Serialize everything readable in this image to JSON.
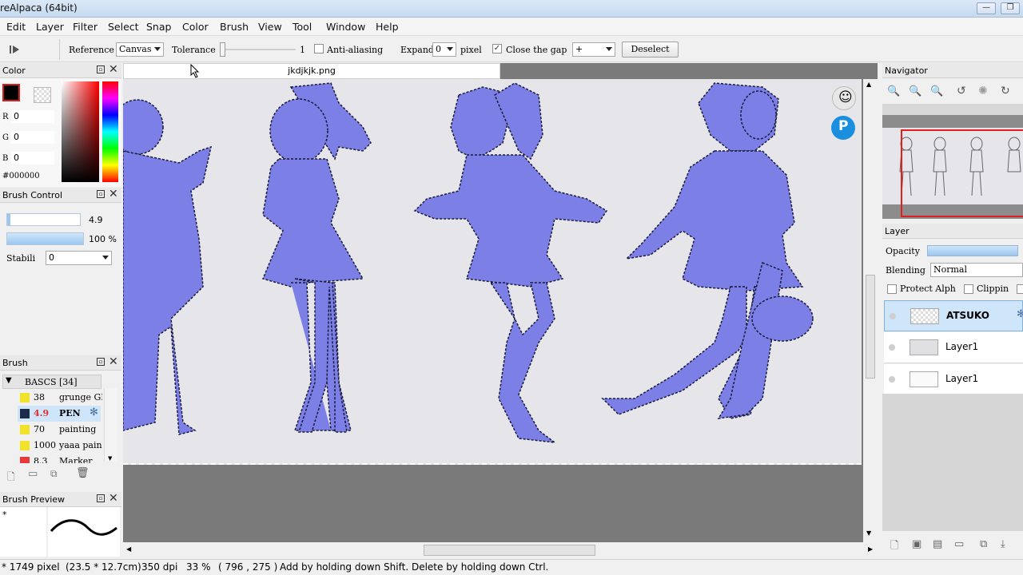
{
  "window": {
    "title": "reAlpaca (64bit)",
    "minimize": "—",
    "maximize": "❐"
  },
  "menu": [
    "Edit",
    "Layer",
    "Filter",
    "Select",
    "Snap",
    "Color",
    "Brush",
    "View",
    "Tool",
    "Window",
    "Help"
  ],
  "toolbar": {
    "reference_label": "Reference",
    "reference_value": "Canvas",
    "tolerance_label": "Tolerance",
    "tolerance_value": "1",
    "antialias_label": "Anti-aliasing",
    "expand_label": "Expand",
    "expand_value": "0",
    "pixel_label": "pixel",
    "close_gap_label": "Close the gap",
    "close_gap_value": "+",
    "deselect_label": "Deselect"
  },
  "color_panel": {
    "title": "Color",
    "r_label": "R",
    "r_value": "0",
    "g_label": "G",
    "g_value": "0",
    "b_label": "B",
    "b_value": "0",
    "hex": "#000000",
    "fg_color": "#000000"
  },
  "brush_control": {
    "title": "Brush Control",
    "size_value": "4.9",
    "opacity_value": "100 %",
    "stabilizer_label": "Stabili",
    "stabilizer_value": "0"
  },
  "brush_panel": {
    "title": "Brush",
    "group": "BASCS [34]",
    "items": [
      {
        "size": "38",
        "name": "grunge GR",
        "color": "#f2e22a"
      },
      {
        "size": "4.9",
        "name": "PEN",
        "color": "#1d2a4a"
      },
      {
        "size": "70",
        "name": "painting",
        "color": "#f2e22a"
      },
      {
        "size": "1000",
        "name": "yaaa pain",
        "color": "#f2e22a"
      },
      {
        "size": "8.3",
        "name": "Marker",
        "color": "#e83a3a"
      }
    ]
  },
  "brush_preview": {
    "title": "Brush Preview",
    "marker": "*"
  },
  "document": {
    "tab": "jkdjkjk.png"
  },
  "navigator": {
    "title": "Navigator"
  },
  "layer_panel": {
    "title": "Layer",
    "opacity_label": "Opacity",
    "blending_label": "Blending",
    "blending_value": "Normal",
    "protect_label": "Protect Alph",
    "clipping_label": "Clippin",
    "layers": [
      {
        "name": "ATSUKO",
        "selected": true
      },
      {
        "name": "Layer1",
        "selected": false
      },
      {
        "name": "Layer1",
        "selected": false
      }
    ]
  },
  "status": {
    "size": "* 1749 pixel",
    "physical": "(23.5 * 12.7cm)",
    "dpi": "350 dpi",
    "zoom": "33 %",
    "coords": "( 796 , 275 )",
    "hint": "Add by holding down Shift. Delete by holding down Ctrl."
  }
}
